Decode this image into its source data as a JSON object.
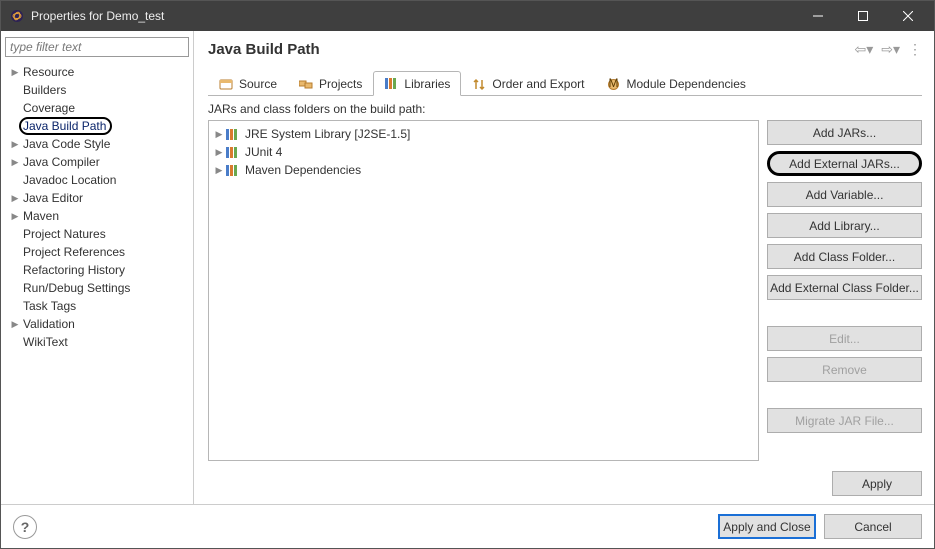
{
  "window": {
    "title": "Properties for Demo_test"
  },
  "filter_placeholder": "type filter text",
  "nav_tree": [
    {
      "label": "Resource",
      "expandable": true,
      "selected": false
    },
    {
      "label": "Builders",
      "expandable": false,
      "selected": false
    },
    {
      "label": "Coverage",
      "expandable": false,
      "selected": false
    },
    {
      "label": "Java Build Path",
      "expandable": false,
      "selected": true,
      "circled": true
    },
    {
      "label": "Java Code Style",
      "expandable": true,
      "selected": false
    },
    {
      "label": "Java Compiler",
      "expandable": true,
      "selected": false
    },
    {
      "label": "Javadoc Location",
      "expandable": false,
      "selected": false
    },
    {
      "label": "Java Editor",
      "expandable": true,
      "selected": false
    },
    {
      "label": "Maven",
      "expandable": true,
      "selected": false
    },
    {
      "label": "Project Natures",
      "expandable": false,
      "selected": false
    },
    {
      "label": "Project References",
      "expandable": false,
      "selected": false
    },
    {
      "label": "Refactoring History",
      "expandable": false,
      "selected": false
    },
    {
      "label": "Run/Debug Settings",
      "expandable": false,
      "selected": false
    },
    {
      "label": "Task Tags",
      "expandable": false,
      "selected": false
    },
    {
      "label": "Validation",
      "expandable": true,
      "selected": false
    },
    {
      "label": "WikiText",
      "expandable": false,
      "selected": false
    }
  ],
  "page": {
    "title": "Java Build Path",
    "section_label": "JARs and class folders on the build path:"
  },
  "tabs": [
    {
      "label": "Source",
      "icon": "source-icon",
      "active": false
    },
    {
      "label": "Projects",
      "icon": "projects-icon",
      "active": false
    },
    {
      "label": "Libraries",
      "icon": "library-icon",
      "active": true
    },
    {
      "label": "Order and Export",
      "icon": "order-icon",
      "active": false
    },
    {
      "label": "Module Dependencies",
      "icon": "module-icon",
      "active": false
    }
  ],
  "lib_items": [
    {
      "label": "JRE System Library [J2SE-1.5]"
    },
    {
      "label": "JUnit 4"
    },
    {
      "label": "Maven Dependencies"
    }
  ],
  "buttons": {
    "add_jars": "Add JARs...",
    "add_external_jars": "Add External JARs...",
    "add_variable": "Add Variable...",
    "add_library": "Add Library...",
    "add_class_folder": "Add Class Folder...",
    "add_ext_class_folder": "Add External Class Folder...",
    "edit": "Edit...",
    "remove": "Remove",
    "migrate": "Migrate JAR File...",
    "apply": "Apply",
    "apply_close": "Apply and Close",
    "cancel": "Cancel"
  }
}
